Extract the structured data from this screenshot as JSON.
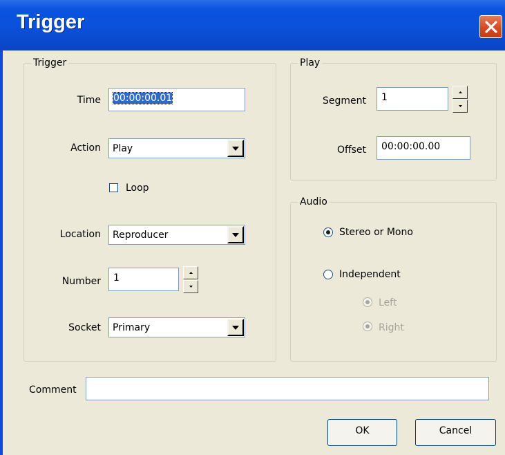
{
  "window": {
    "title": "Trigger"
  },
  "trigger_group": {
    "legend": "Trigger",
    "time_label": "Time",
    "time_value": "00:00:00.01",
    "action_label": "Action",
    "action_value": "Play",
    "loop_label": "Loop",
    "loop_checked": false,
    "location_label": "Location",
    "location_value": "Reproducer",
    "number_label": "Number",
    "number_value": "1",
    "socket_label": "Socket",
    "socket_value": "Primary"
  },
  "play_group": {
    "legend": "Play",
    "segment_label": "Segment",
    "segment_value": "1",
    "offset_label": "Offset",
    "offset_value": "00:00:00.00"
  },
  "audio_group": {
    "legend": "Audio",
    "stereo_label": "Stereo or Mono",
    "stereo_selected": true,
    "independent_label": "Independent",
    "left_label": "Left",
    "right_label": "Right"
  },
  "comment": {
    "label": "Comment",
    "value": ""
  },
  "buttons": {
    "ok": "OK",
    "cancel": "Cancel"
  }
}
